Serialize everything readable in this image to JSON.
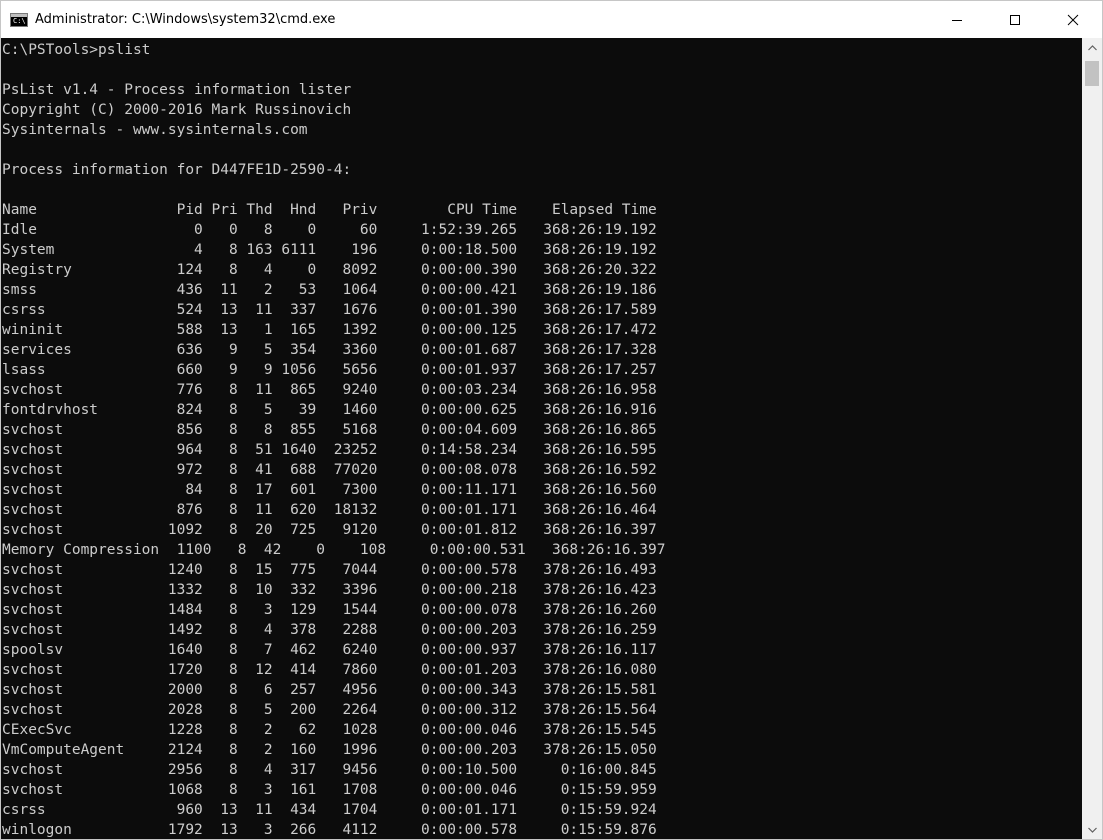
{
  "window": {
    "title": "Administrator: C:\\Windows\\system32\\cmd.exe",
    "icon_text": "C:\\"
  },
  "console": {
    "lines": [
      "C:\\PSTools>pslist",
      "",
      "PsList v1.4 - Process information lister",
      "Copyright (C) 2000-2016 Mark Russinovich",
      "Sysinternals - www.sysinternals.com",
      "",
      "Process information for D447FE1D-2590-4:",
      "",
      "Name                Pid Pri Thd  Hnd   Priv        CPU Time    Elapsed Time",
      "Idle                  0   0   8    0     60     1:52:39.265   368:26:19.192",
      "System                4   8 163 6111    196     0:00:18.500   368:26:19.192",
      "Registry            124   8   4    0   8092     0:00:00.390   368:26:20.322",
      "smss                436  11   2   53   1064     0:00:00.421   368:26:19.186",
      "csrss               524  13  11  337   1676     0:00:01.390   368:26:17.589",
      "wininit             588  13   1  165   1392     0:00:00.125   368:26:17.472",
      "services            636   9   5  354   3360     0:00:01.687   368:26:17.328",
      "lsass               660   9   9 1056   5656     0:00:01.937   368:26:17.257",
      "svchost             776   8  11  865   9240     0:00:03.234   368:26:16.958",
      "fontdrvhost         824   8   5   39   1460     0:00:00.625   368:26:16.916",
      "svchost             856   8   8  855   5168     0:00:04.609   368:26:16.865",
      "svchost             964   8  51 1640  23252     0:14:58.234   368:26:16.595",
      "svchost             972   8  41  688  77020     0:00:08.078   368:26:16.592",
      "svchost              84   8  17  601   7300     0:00:11.171   368:26:16.560",
      "svchost             876   8  11  620  18132     0:00:01.171   368:26:16.464",
      "svchost            1092   8  20  725   9120     0:00:01.812   368:26:16.397",
      "Memory Compression  1100   8  42    0    108     0:00:00.531   368:26:16.397",
      "svchost            1240   8  15  775   7044     0:00:00.578   378:26:16.493",
      "svchost            1332   8  10  332   3396     0:00:00.218   378:26:16.423",
      "svchost            1484   8   3  129   1544     0:00:00.078   378:26:16.260",
      "svchost            1492   8   4  378   2288     0:00:00.203   378:26:16.259",
      "spoolsv            1640   8   7  462   6240     0:00:00.937   378:26:16.117",
      "svchost            1720   8  12  414   7860     0:00:01.203   378:26:16.080",
      "svchost            2000   8   6  257   4956     0:00:00.343   378:26:15.581",
      "svchost            2028   8   5  200   2264     0:00:00.312   378:26:15.564",
      "CExecSvc           1228   8   2   62   1028     0:00:00.046   378:26:15.545",
      "VmComputeAgent     2124   8   2  160   1996     0:00:00.203   378:26:15.050",
      "svchost            2956   8   4  317   9456     0:00:10.500     0:16:00.845",
      "svchost            1068   8   3  161   1708     0:00:00.046     0:15:59.959",
      "csrss               960  13  11  434   1704     0:00:01.171     0:15:59.924",
      "winlogon           1792  13   3  266   4112     0:00:00.578     0:15:59.876"
    ]
  }
}
